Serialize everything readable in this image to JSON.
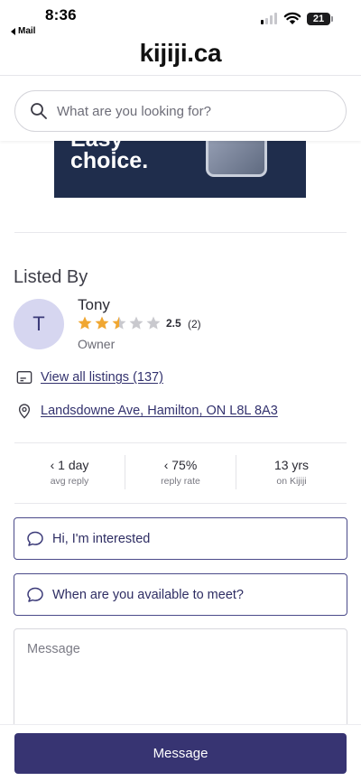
{
  "status_bar": {
    "time": "8:36",
    "back_app": "Mail",
    "battery": "21"
  },
  "header": {
    "logo": "kijiji.ca"
  },
  "search": {
    "placeholder": "What are you looking for?"
  },
  "ad": {
    "line1": "Easy",
    "line2": "choice."
  },
  "listed_by": {
    "title": "Listed By",
    "avatar_initial": "T",
    "name": "Tony",
    "rating": "2.5",
    "rating_value": 2.5,
    "rating_max": 5,
    "rating_count": "(2)",
    "role": "Owner",
    "view_listings": "View all listings (137)",
    "address": "Landsdowne Ave, Hamilton, ON L8L 8A3"
  },
  "stats": [
    {
      "value": "‹ 1 day",
      "label": "avg reply"
    },
    {
      "value": "‹ 75%",
      "label": "reply rate"
    },
    {
      "value": "13 yrs",
      "label": "on Kijiji"
    }
  ],
  "quick_replies": [
    "Hi, I'm interested",
    "When are you available to meet?"
  ],
  "message": {
    "placeholder": "Message",
    "button": "Message"
  },
  "colors": {
    "accent": "#373472",
    "star": "#f0a732",
    "star_empty": "#c9c9ce",
    "ad_bg": "#1f2d4c"
  },
  "icons": [
    "search-icon",
    "star-icon",
    "listings-icon",
    "location-pin-icon",
    "chat-bubble-icon",
    "wifi-icon",
    "signal-icon",
    "battery-icon"
  ]
}
